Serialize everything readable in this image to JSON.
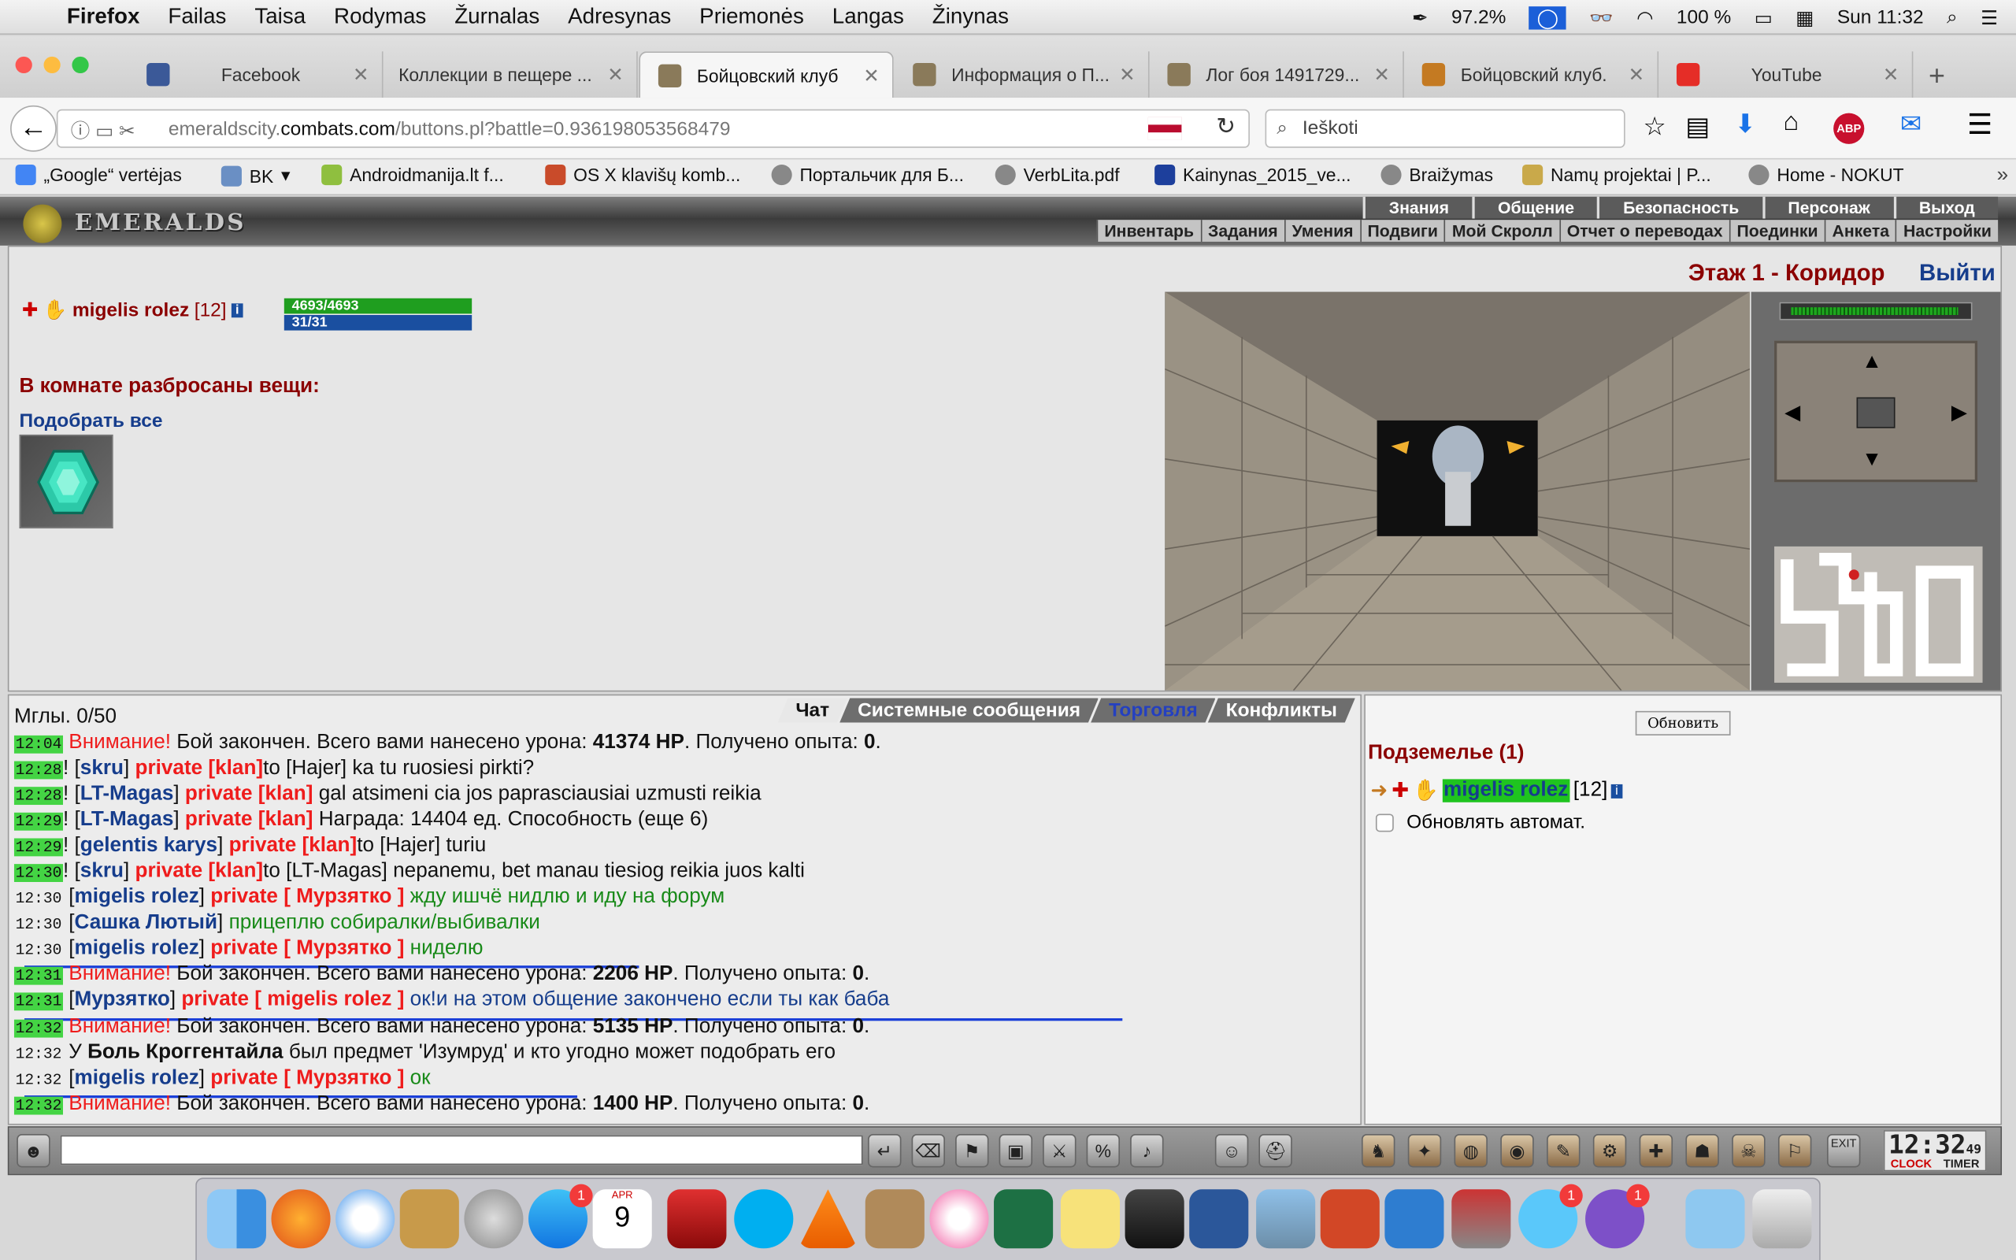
{
  "menubar": {
    "app": "Firefox",
    "items": [
      "Failas",
      "Taisa",
      "Rodymas",
      "Žurnalas",
      "Adresynas",
      "Priemonės",
      "Langas",
      "Žinynas"
    ],
    "battery_left": "97.2%",
    "battery_right": "100 %",
    "clock": "Sun 11:32"
  },
  "tabs": [
    {
      "label": "Facebook",
      "icon": "facebook-icon",
      "color": "#3b5998"
    },
    {
      "label": "Коллекции в пещере ...",
      "icon": "page-icon",
      "color": "#cccccc"
    },
    {
      "label": "Бойцовский клуб",
      "icon": "crossed-swords-icon",
      "color": "#8a7a5a"
    },
    {
      "label": "Информация о П...",
      "icon": "crossed-swords-icon",
      "color": "#8a7a5a"
    },
    {
      "label": "Лог боя 1491729...",
      "icon": "crossed-swords-icon",
      "color": "#8a7a5a"
    },
    {
      "label": "Бойцовский клуб.",
      "icon": "warrior-icon",
      "color": "#c47a22"
    },
    {
      "label": "YouTube",
      "icon": "youtube-icon",
      "color": "#e52d27"
    }
  ],
  "address": {
    "prefix": "emeraldscity.",
    "domain": "combats.com",
    "path": "/buttons.pl?battle=0.936198053568479",
    "search_placeholder": "Ieškoti"
  },
  "bookmarks": [
    "„Google“ vertėjas",
    "BK",
    "Androidmanija.lt f...",
    "OS X klavišų komb...",
    "Портальчик для Б...",
    "VerbLita.pdf",
    "Kainynas_2015_ve...",
    "Braižymas",
    "Namų projektai | P...",
    "Home - NOKUT"
  ],
  "game": {
    "logo": "EMERALDS",
    "nav_main": [
      "Знания",
      "Общение",
      "Безопасность",
      "Персонаж",
      "Выход"
    ],
    "nav_sub": [
      "Инвентарь",
      "Задания",
      "Умения",
      "Подвиги",
      "Мой Скролл",
      "Отчет о переводах",
      "Поединки",
      "Анкета",
      "Настройки"
    ],
    "player_name": "migelis rolez",
    "player_level": "[12]",
    "hp": "4693/4693",
    "mana": "31/31",
    "room_items_title": "В комнате разбросаны вещи:",
    "pickup_all": "Подобрать все",
    "location": "Этаж 1 - Коридор",
    "exit": "Выйти"
  },
  "chat": {
    "tabs": [
      "Чат",
      "Системные сообщения",
      "Торговля",
      "Конфликты"
    ],
    "partial_line": "Мглы. 0/50",
    "lines": [
      {
        "time": "12:04",
        "hl": true,
        "a": "Внимание!",
        "b": " Бой закончен. Всего вами нанесено урона: ",
        "c": "41374 HP",
        "d": ". Получено опыта: ",
        "e": "0",
        "f": "."
      },
      {
        "time": "12:28",
        "hl": true,
        "from": "skru",
        "to": "private [klan]",
        "msg": "to [Hajer] ka tu ruosiesi pirkti?"
      },
      {
        "time": "12:28",
        "hl": true,
        "from": "LT-Magas",
        "to": "private [klan]",
        "msg": " gal atsimeni cia jos paprasciausiai uzmusti reikia"
      },
      {
        "time": "12:29",
        "hl": true,
        "from": "LT-Magas",
        "to": "private [klan]",
        "msg": " Награда: 14404 ед. Способность (еще 6)"
      },
      {
        "time": "12:29",
        "hl": true,
        "from": "gelentis karys",
        "to": "private [klan]",
        "msg": "to [Hajer] turiu"
      },
      {
        "time": "12:30",
        "hl": true,
        "from": "skru",
        "to": "private [klan]",
        "msg": "to [LT-Magas] nepanemu, bet manau tiesiog reikia juos kalti"
      },
      {
        "time": "12:30",
        "hl": false,
        "from": "migelis rolez",
        "to": "private [ Мурзятко ]",
        "msg": " жду ишчё нидлю и иду на форум"
      },
      {
        "time": "12:30",
        "hl": false,
        "from": "Сашка Лютый",
        "to": "",
        "msg": " прицеплю собиралки/выбивалки"
      },
      {
        "time": "12:30",
        "hl": false,
        "from": "migelis rolez",
        "to": "private [ Мурзятко ]",
        "msg": " ниделю"
      },
      {
        "time": "12:31",
        "hl": true,
        "a": "Внимание!",
        "b": " Бой закончен. Всего вами нанесено урона: ",
        "c": "2206 HP",
        "d": ". Получено опыта: ",
        "e": "0",
        "f": "."
      },
      {
        "time": "12:31",
        "hl": true,
        "from": "Мурзятко",
        "to": "private [ migelis rolez ]",
        "msg": " ок!и на этом общение закончено если ты как баба"
      },
      {
        "time": "12:32",
        "hl": true,
        "a": "Внимание!",
        "b": " Бой закончен. Всего вами нанесено урона: ",
        "c": "5135 HP",
        "d": ". Получено опыта: ",
        "e": "0",
        "f": "."
      },
      {
        "time": "12:32",
        "hl": false,
        "sys1": "У ",
        "sys2": "Боль Кроггентайла",
        "sys3": " был предмет 'Изумруд' и кто угодно может подобрать его"
      },
      {
        "time": "12:32",
        "hl": false,
        "from": "migelis rolez",
        "to": "private [ Мурзятко ]",
        "msg": " ок"
      },
      {
        "time": "12:32",
        "hl": true,
        "a": "Внимание!",
        "b": " Бой закончен. Всего вами нанесено урона: ",
        "c": "1400 HP",
        "d": ". Получено опыта: ",
        "e": "0",
        "f": "."
      }
    ]
  },
  "right": {
    "refresh": "Обновить",
    "dungeon": "Подземелье (1)",
    "player": "migelis rolez",
    "level": "[12]",
    "auto_refresh": "Обновлять автомат."
  },
  "toolbar": {
    "clock": "12:32",
    "seconds": "49",
    "clock_label": "CLOCK",
    "timer_label": "TIMER",
    "exit_label": "EXIT"
  },
  "dock": {
    "calendar_month": "APR",
    "calendar_day": "9",
    "badges": [
      "1",
      "1",
      "1"
    ]
  }
}
